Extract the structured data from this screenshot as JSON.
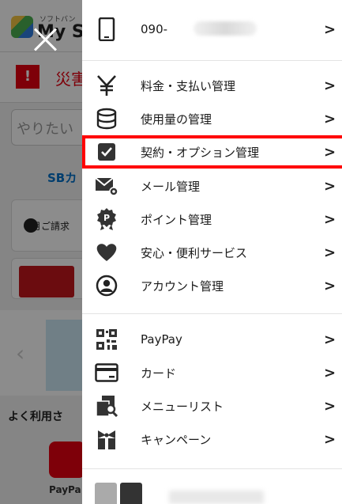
{
  "background": {
    "brand_small": "ソフトバン",
    "brand": "My S",
    "alert_badge": "!",
    "alert_text": "災害",
    "search_placeholder": "やりたい",
    "sb_link": "SBカ",
    "card_text": "月ご請求",
    "frequent_heading": "よく利用さ",
    "paypay_label": "PayPa"
  },
  "drawer": {
    "phone": "090-",
    "chevron": ">",
    "section1": [
      {
        "label": "料金・支払い管理",
        "icon": "yen-icon"
      },
      {
        "label": "使用量の管理",
        "icon": "database-icon"
      },
      {
        "label": "契約・オプション管理",
        "icon": "checkbox-icon"
      },
      {
        "label": "メール管理",
        "icon": "mail-settings-icon"
      },
      {
        "label": "ポイント管理",
        "icon": "point-badge-icon"
      },
      {
        "label": "安心・便利サービス",
        "icon": "heart-icon"
      },
      {
        "label": "アカウント管理",
        "icon": "account-icon"
      }
    ],
    "section2": [
      {
        "label": "PayPay",
        "icon": "qr-code-icon"
      },
      {
        "label": "カード",
        "icon": "card-icon"
      },
      {
        "label": "メニューリスト",
        "icon": "menu-search-icon"
      },
      {
        "label": "キャンペーン",
        "icon": "gift-icon"
      }
    ]
  },
  "colors": {
    "highlight": "#ff0000",
    "accent_red": "#e60012"
  }
}
